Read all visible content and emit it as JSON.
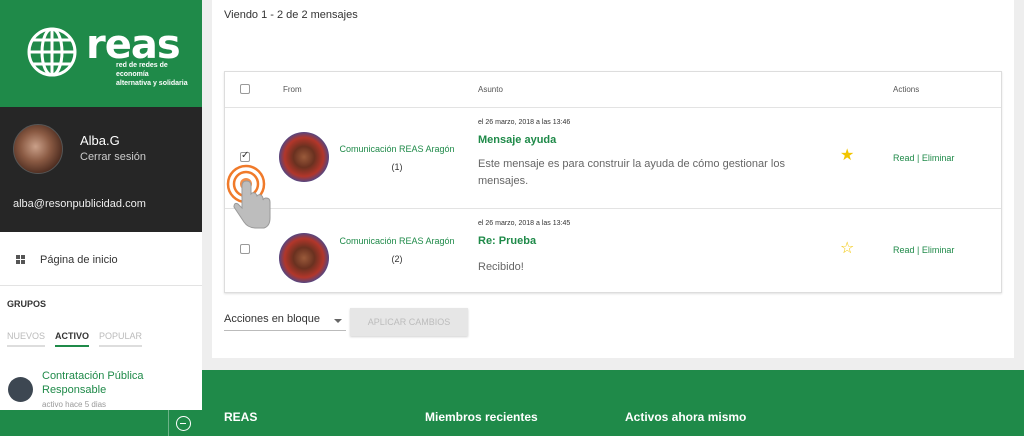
{
  "brand": {
    "name": "reas",
    "tagline_line1": "red de redes de economía",
    "tagline_line2": "alternativa y solidaria",
    "green": "#1f8a49"
  },
  "user": {
    "name": "Alba.G",
    "logout": "Cerrar sesión",
    "email": "alba@resonpublicidad.com"
  },
  "nav": {
    "home": "Página de inicio",
    "home_icon": "grid-icon"
  },
  "groups": {
    "title": "GRUPOS",
    "tabs": [
      "NUEVOS",
      "ACTIVO",
      "POPULAR"
    ],
    "active_tab": "ACTIVO",
    "item": {
      "title": "Contratación Pública Responsable",
      "activity": "activo hace 5 dias"
    }
  },
  "messages": {
    "viewing": "Viendo 1 - 2 de 2 mensajes",
    "columns": {
      "from": "From",
      "subject": "Asunto",
      "actions": "Actions"
    },
    "rows": [
      {
        "checked": true,
        "sender": "Comunicación REAS Aragón",
        "count": "(1)",
        "date": "el 26 marzo, 2018 a las 13:46",
        "subject": "Mensaje ayuda",
        "excerpt": "Este mensaje es para construir la ayuda de cómo gestionar los mensajes.",
        "starred": true,
        "read": "Read",
        "separator": "|",
        "delete": "Eliminar"
      },
      {
        "checked": false,
        "sender": "Comunicación REAS Aragón",
        "count": "(2)",
        "date": "el 26 marzo, 2018 a las 13:45",
        "subject": "Re: Prueba",
        "excerpt": "Recibido!",
        "starred": false,
        "read": "Read",
        "separator": "|",
        "delete": "Eliminar"
      }
    ],
    "bulk_actions": "Acciones en bloque",
    "apply": "APLICAR CAMBIOS"
  },
  "footer": {
    "col1": "REAS",
    "col2": "Miembros recientes",
    "col3": "Activos ahora mismo"
  }
}
